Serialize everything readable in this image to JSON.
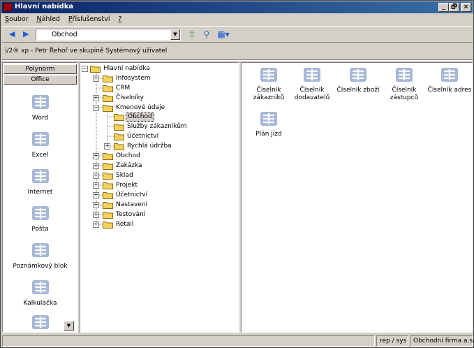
{
  "window": {
    "title": "Hlavní nabídka",
    "controls": {
      "minimize": "_",
      "maximize": "🗗",
      "close": "×"
    }
  },
  "menu": [
    {
      "accel": "S",
      "rest": "oubor"
    },
    {
      "accel": "N",
      "rest": "áhled"
    },
    {
      "accel": "P",
      "rest": "říslušenství"
    },
    {
      "accel": "?",
      "rest": ""
    }
  ],
  "toolbar": {
    "address_value": "Obchod"
  },
  "info_line": "i/2® xp - Petr Řehoř ve skupině Systémový uživatel",
  "left_pane": {
    "groups": [
      "Polynorm",
      "Office"
    ],
    "items": [
      "Word",
      "Excel",
      "Internet",
      "Pošta",
      "Poznámkový blok",
      "Kalkulačka"
    ]
  },
  "tree": {
    "root": "Hlavní nabídka",
    "infosystem": "Infosystem",
    "crm": "CRM",
    "ciselniky": "Číselníky",
    "kmenove": "Kmenové údaje",
    "kmenove_children": [
      "Obchod",
      "Služby zákazníkům",
      "Účetnictví",
      "Rychlá údržba"
    ],
    "rest": [
      "Obchod",
      "Zakázka",
      "Sklad",
      "Projekt",
      "Účetnictví",
      "Nastavení",
      "Testování",
      "Retail"
    ]
  },
  "right_pane": {
    "items": [
      {
        "line1": "Číselník",
        "line2": "zákazníků"
      },
      {
        "line1": "Číselník",
        "line2": "dodavatelů"
      },
      {
        "line1": "Číselník zboží",
        "line2": ""
      },
      {
        "line1": "Číselník",
        "line2": "zástupců"
      },
      {
        "line1": "Číselník adres",
        "line2": ""
      },
      {
        "line1": "Plán jízd",
        "line2": ""
      }
    ]
  },
  "status": {
    "user": "rep / sys",
    "company": "Obchodní firma a.s."
  },
  "colors": {
    "titlebar": "#0a246a",
    "icon": "#a7b8d6",
    "folder": "#f3d35b"
  }
}
